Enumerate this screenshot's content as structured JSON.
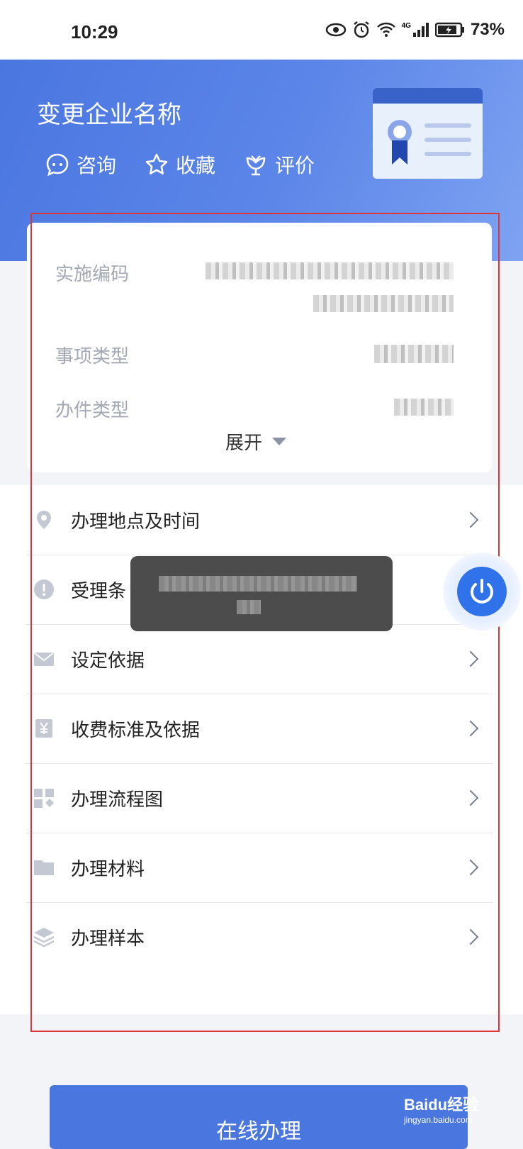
{
  "status_bar": {
    "time": "10:29",
    "network": "4G",
    "battery": "73%"
  },
  "header": {
    "title": "变更企业名称",
    "actions": [
      {
        "label": "咨询",
        "icon": "chat-icon"
      },
      {
        "label": "收藏",
        "icon": "star-icon"
      },
      {
        "label": "评价",
        "icon": "flower-icon"
      }
    ]
  },
  "info_card": {
    "rows": [
      {
        "label": "实施编码"
      },
      {
        "label": "事项类型"
      },
      {
        "label": "办件类型"
      }
    ],
    "expand_label": "展开"
  },
  "menu": {
    "items": [
      {
        "label": "办理地点及时间",
        "icon": "location-icon"
      },
      {
        "label": "受理条",
        "icon": "alert-icon"
      },
      {
        "label": "设定依据",
        "icon": "mail-icon"
      },
      {
        "label": "收费标准及依据",
        "icon": "yen-icon"
      },
      {
        "label": "办理流程图",
        "icon": "grid-icon"
      },
      {
        "label": "办理材料",
        "icon": "folder-icon"
      },
      {
        "label": "办理样本",
        "icon": "layers-icon"
      }
    ]
  },
  "footer": {
    "button_label": "在线办理"
  },
  "watermark": {
    "brand": "Baidu经验",
    "url": "jingyan.baidu.com"
  },
  "colors": {
    "brand_blue": "#4a76e0",
    "float_blue": "#2f72ea",
    "highlight_red": "#e0343b"
  }
}
